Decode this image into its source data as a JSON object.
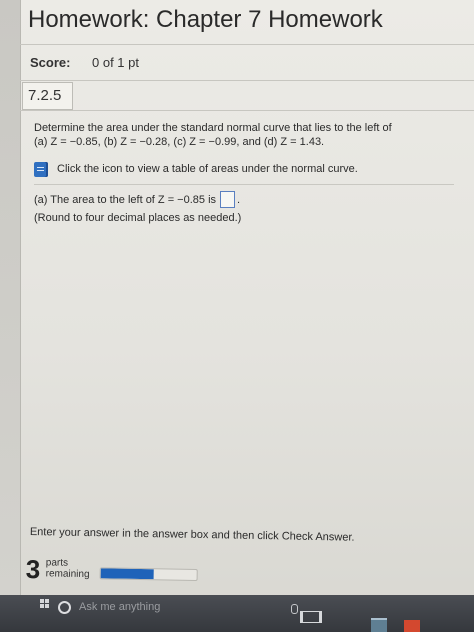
{
  "header": {
    "title": "Homework: Chapter 7 Homework"
  },
  "score": {
    "label": "Score:",
    "value": "0 of 1 pt"
  },
  "question": {
    "number": "7.2.5",
    "prompt_line1": "Determine the area under the standard normal curve that lies to the left of",
    "prompt_line2": "(a) Z = −0.85, (b) Z = −0.28, (c) Z = −0.99, and (d) Z = 1.43.",
    "table_link": "Click the icon to view a table of areas under the normal curve.",
    "part_a_text": "(a) The area to the left of Z = −0.85 is",
    "part_a_value": "",
    "part_a_suffix": ".",
    "round_note": "(Round to four decimal places as needed.)"
  },
  "footer": {
    "instruction": "Enter your answer in the answer box and then click Check Answer.",
    "parts_count": "3",
    "parts_label_line1": "parts",
    "parts_label_line2": "remaining",
    "progress_fraction": 0.55
  },
  "taskbar": {
    "search_placeholder": "Ask me anything"
  },
  "icons": {
    "table": "book-icon",
    "search": "search-icon",
    "start": "windows-start-icon",
    "mic": "microphone-icon",
    "taskview": "task-view-icon"
  },
  "colors": {
    "accent": "#1f63b9",
    "icon_blue": "#2f6fc0"
  }
}
